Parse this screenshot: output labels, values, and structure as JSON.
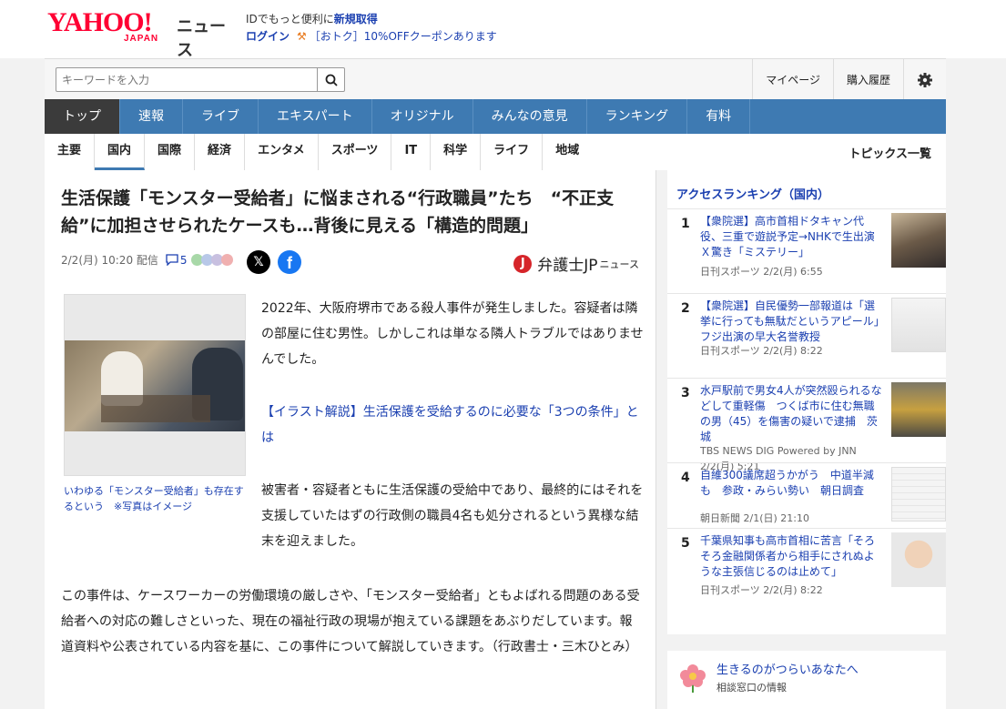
{
  "header": {
    "logo_yahoo": "YAHOO!",
    "logo_japan": "JAPAN",
    "logo_news": "ニュース",
    "promo_text": "IDでもっと便利に",
    "promo_link": "新規取得",
    "login": "ログイン",
    "coupon": "［おトク］10%OFFクーポンあります"
  },
  "search": {
    "placeholder": "キーワードを入力"
  },
  "toplinks": {
    "mypage": "マイページ",
    "history": "購入履歴"
  },
  "mainnav": [
    "トップ",
    "速報",
    "ライブ",
    "エキスパート",
    "オリジナル",
    "みんなの意見",
    "ランキング",
    "有料"
  ],
  "subnav": {
    "items": [
      "主要",
      "国内",
      "国際",
      "経済",
      "エンタメ",
      "スポーツ",
      "IT",
      "科学",
      "ライフ",
      "地域"
    ],
    "topics": "トピックス一覧"
  },
  "article": {
    "title": "生活保護「モンスター受給者」に悩まされる“行政職員”たち　“不正支給”に加担させられたケースも…背後に見える「構造的問題」",
    "date": "2/2(月) 10:20 配信",
    "comments": "5",
    "source_name": "弁護士JP",
    "source_suffix": "ニュース",
    "caption": "いわゆる「モンスター受給者」も存在するという　※写真はイメージ",
    "p1": "2022年、大阪府堺市である殺人事件が発生しました。容疑者は隣の部屋に住む男性。しかしこれは単なる隣人トラブルではありませんでした。",
    "link": "【イラスト解説】生活保護を受給するのに必要な「3つの条件」とは",
    "p2": "被害者・容疑者ともに生活保護の受給中であり、最終的にはそれを支援していたはずの行政側の職員4名も処分されるという異様な結末を迎えました。",
    "p3": "この事件は、ケースワーカーの労働環境の厳しさや、「モンスター受給者」ともよばれる問題のある受給者への対応の難しさといった、現在の福祉行政の現場が抱えている課題をあぶりだしています。報道資料や公表されている内容を基に、この事件について解説していきます。（行政書士・三木ひとみ）"
  },
  "ranking": {
    "heading": "アクセスランキング（国内）",
    "items": [
      {
        "num": "1",
        "title": "【衆院選】高市首相ドタキャン代役、三重で遊説予定→NHKで生出演　Ｘ驚き「ミステリー」",
        "source": "日刊スポーツ 2/2(月) 6:55"
      },
      {
        "num": "2",
        "title": "【衆院選】自民優勢一部報道は「選挙に行っても無駄だというアピール」フジ出演の早大名誉教授",
        "source": "日刊スポーツ 2/2(月) 8:22"
      },
      {
        "num": "3",
        "title": "水戸駅前で男女4人が突然殴られるなどして重軽傷　つくば市に住む無職の男（45）を傷害の疑いで逮捕　茨城",
        "source": "TBS NEWS DIG Powered by JNN 2/2(月) 5:21"
      },
      {
        "num": "4",
        "title": "自維300議席超うかがう　中道半減も　参政・みらい勢い　朝日調査",
        "source": "朝日新聞 2/1(日) 21:10"
      },
      {
        "num": "5",
        "title": "千葉県知事も高市首相に苦言「そろそろ金融関係者から相手にされぬような主張信じるのは止めて」",
        "source": "日刊スポーツ 2/2(月) 8:22"
      }
    ]
  },
  "support": {
    "title": "生きるのがつらいあなたへ",
    "sub": "相談窓口の情報"
  },
  "colors": {
    "brand_red": "#ff0033",
    "nav_blue": "#3e7ab2",
    "link_blue": "#1a3fb0"
  }
}
